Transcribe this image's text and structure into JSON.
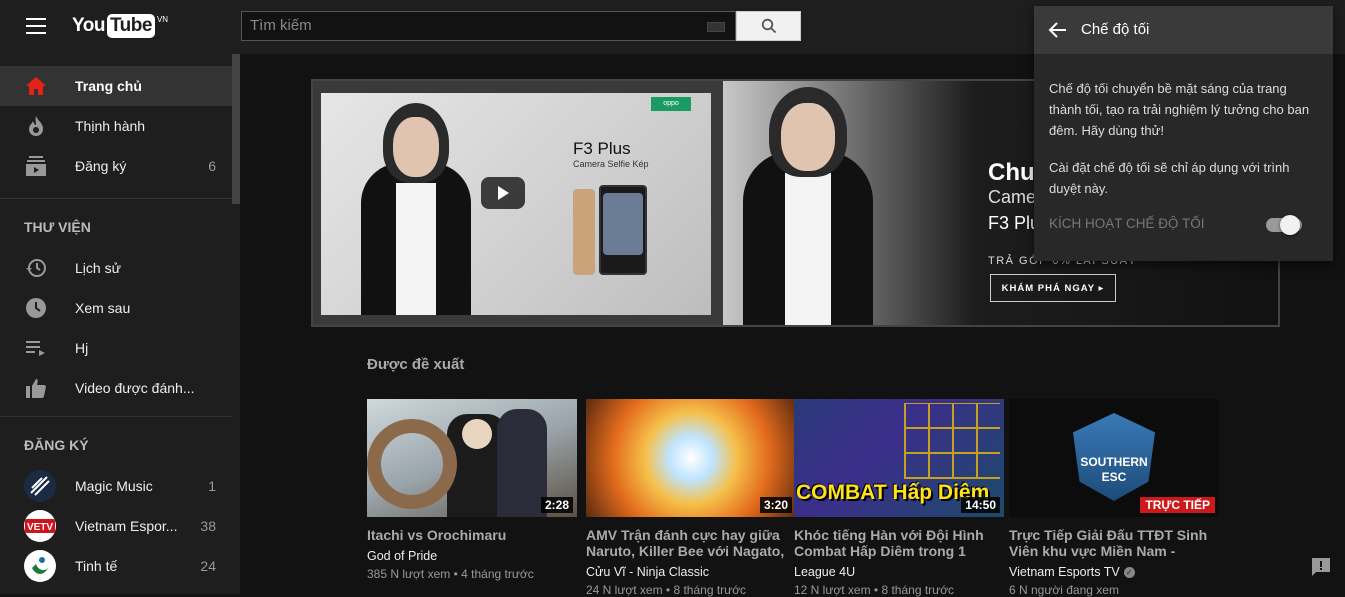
{
  "header": {
    "logo_you": "You",
    "logo_tube": "Tube",
    "logo_region": "VN",
    "search_placeholder": "Tìm kiếm"
  },
  "sidebar": {
    "main_items": [
      {
        "label": "Trang chủ",
        "count": "",
        "icon": "home-icon"
      },
      {
        "label": "Thịnh hành",
        "count": "",
        "icon": "trending-icon"
      },
      {
        "label": "Đăng ký",
        "count": "6",
        "icon": "subscriptions-icon"
      }
    ],
    "library_heading": "THƯ VIỆN",
    "library_items": [
      {
        "label": "Lịch sử",
        "icon": "history-icon"
      },
      {
        "label": "Xem sau",
        "icon": "clock-icon"
      },
      {
        "label": "Hj",
        "icon": "playlist-icon"
      },
      {
        "label": "Video được đánh...",
        "icon": "thumbs-up-icon"
      }
    ],
    "subs_heading": "ĐĂNG KÝ",
    "subs_items": [
      {
        "label": "Magic Music",
        "count": "1"
      },
      {
        "label": "Vietnam Espor...",
        "count": "38"
      },
      {
        "label": "Tinh tế",
        "count": "24"
      }
    ]
  },
  "banner": {
    "oppo": "oppo",
    "f3_title": "F3 Plus",
    "f3_sub": "Camera Selfie Kép",
    "promo_title": "Chu",
    "promo_sub": "Came",
    "promo_sub2": "F3 Plu",
    "promo_installment": "TRẢ GÓP 0% LÃI SUẤT",
    "promo_button": "KHÁM PHÁ NGAY ▸"
  },
  "recommended": {
    "title": "Được đề xuất",
    "videos": [
      {
        "title": "Itachi vs Orochimaru",
        "title2": "",
        "channel": "God of Pride",
        "meta": "385 N lượt xem • 4 tháng trước",
        "duration": "2:28",
        "verified": false
      },
      {
        "title": "AMV Trận đánh cực hay giữa",
        "title2": "Naruto, Killer Bee với Nagato,",
        "channel": "Cửu Vĩ - Ninja Classic",
        "meta": "24 N lượt xem • 8 tháng trước",
        "duration": "3:20",
        "verified": false
      },
      {
        "title": "Khóc tiếng Hàn với Đội Hình",
        "title2": "Combat Hấp Diêm trong 1",
        "channel": "League 4U",
        "meta": "12 N lượt xem • 8 tháng trước",
        "duration": "14:50",
        "verified": false
      },
      {
        "title": "Trực Tiếp Giải Đấu TTĐT Sinh",
        "title2": "Viên khu vực Miền Nam -",
        "channel": "Vietnam Esports TV",
        "meta": "6 N người đang xem",
        "duration": "TRỰC TIẾP",
        "verified": true
      }
    ],
    "thumb_texts": {
      "combat": "COMBAT Hấp Diêm",
      "southern": "SOUTHERN",
      "esc": "ESC"
    }
  },
  "dark_mode_popup": {
    "title": "Chế độ tối",
    "description1": "Chế độ tối chuyển bề mặt sáng của trang thành tối, tạo ra trải nghiệm lý tưởng cho ban đêm. Hãy dùng thử!",
    "description2": "Cài đặt chế độ tối sẽ chỉ áp dụng với trình duyệt này.",
    "toggle_label": "KÍCH HOẠT CHẾ ĐỘ TỐI",
    "toggle_on": false
  },
  "colors": {
    "accent_red": "#cc1a1a",
    "sidebar_bg": "#1e1e1e",
    "page_bg": "#121212"
  }
}
